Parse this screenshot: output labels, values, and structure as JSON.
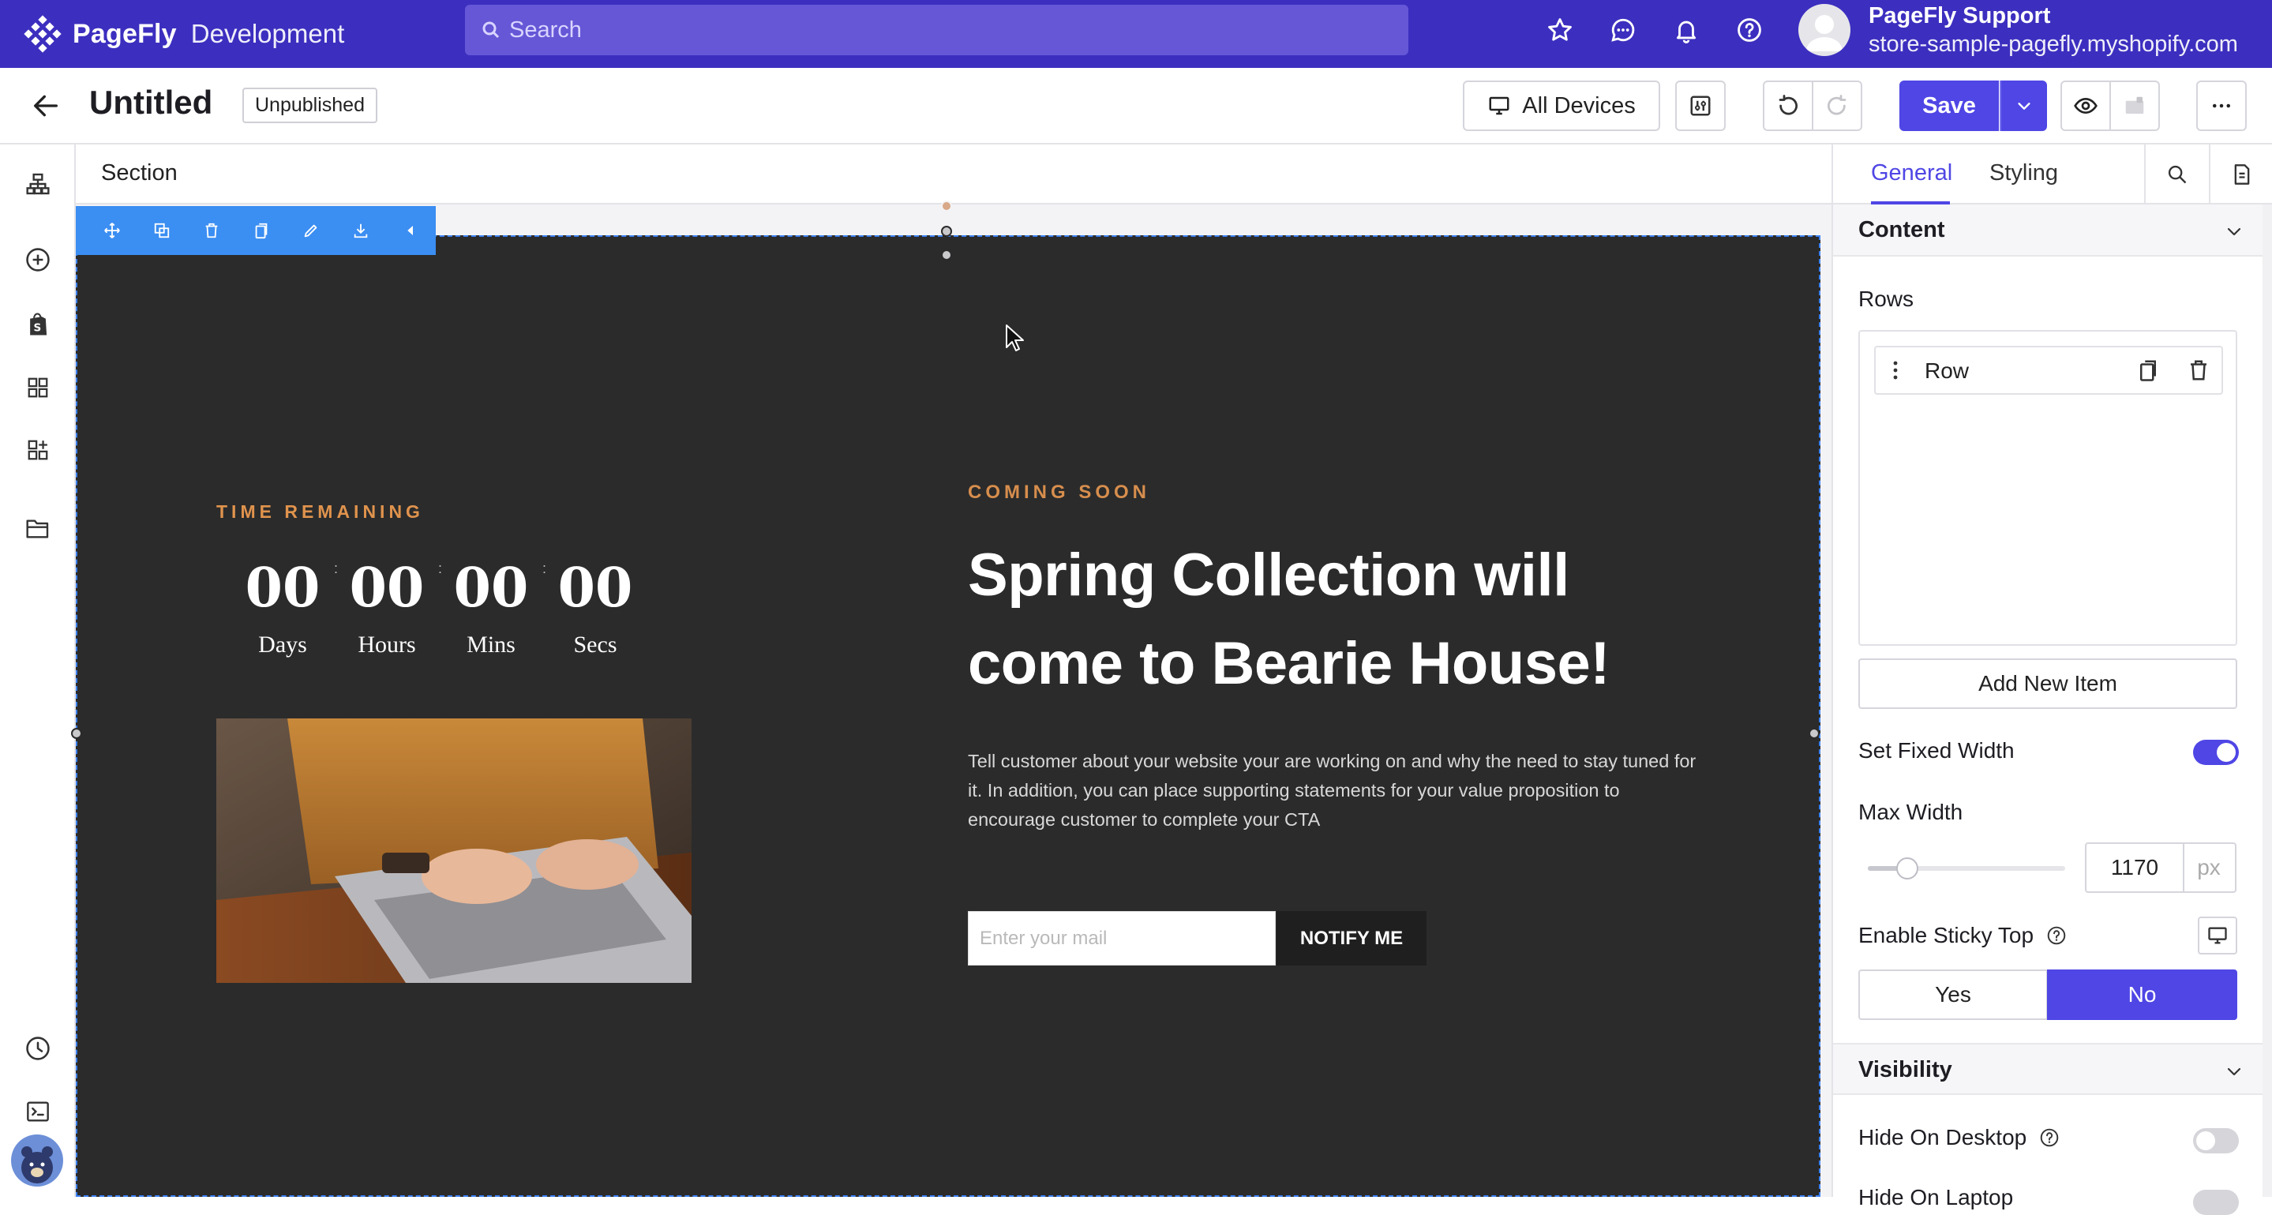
{
  "topbar": {
    "brand_name": "PageFly",
    "brand_env": "Development",
    "search_placeholder": "Search",
    "user_name": "PageFly Support",
    "user_store": "store-sample-pagefly.myshopify.com"
  },
  "header": {
    "title": "Untitled",
    "status": "Unpublished",
    "devices_label": "All Devices",
    "save_label": "Save"
  },
  "canvas": {
    "breadcrumb": "Section",
    "section": {
      "time_label": "TIME REMAINING",
      "countdown": [
        {
          "value": "00",
          "label": "Days"
        },
        {
          "value": "00",
          "label": "Hours"
        },
        {
          "value": "00",
          "label": "Mins"
        },
        {
          "value": "00",
          "label": "Secs"
        }
      ],
      "coming_label": "COMING SOON",
      "headline_line1": "Spring Collection will",
      "headline_line2": "come to Bearie House!",
      "description": "Tell customer about your website your are working on and why the need to stay tuned for it. In addition, you can place supporting statements for your value proposition to encourage customer to complete your CTA",
      "email_placeholder": "Enter your mail",
      "notify_label": "NOTIFY ME"
    }
  },
  "rightpanel": {
    "tabs": [
      "General",
      "Styling"
    ],
    "content_header": "Content",
    "rows_label": "Rows",
    "row_item_label": "Row",
    "add_item_label": "Add New Item",
    "fixed_width_label": "Set Fixed Width",
    "fixed_width_on": true,
    "max_width_label": "Max Width",
    "max_width_value": "1170",
    "max_width_unit": "px",
    "max_width_slider_fraction": 0.2,
    "sticky_label": "Enable Sticky Top",
    "sticky_yes": "Yes",
    "sticky_no": "No",
    "visibility_header": "Visibility",
    "hide_desktop_label": "Hide On Desktop",
    "hide_desktop_on": false,
    "hide_laptop_label": "Hide On Laptop"
  },
  "colors": {
    "topbar": "#3c2fbf",
    "accent": "#4f46e5",
    "section_bg": "#2b2b2b",
    "gold": "#e0934d",
    "selection": "#3b8ef2"
  }
}
